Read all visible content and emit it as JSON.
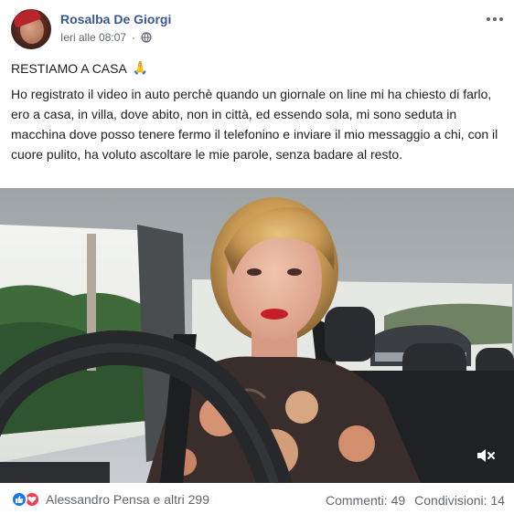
{
  "post": {
    "author": "Rosalba De Giorgi",
    "time": "Ieri alle 08:07",
    "privacy_icon": "globe-icon",
    "title": "RESTIAMO A CASA",
    "title_emoji": "🙏",
    "body": "Ho registrato il video in auto perchè quando un giornale on line mi ha chiesto di farlo, ero a casa, in villa, dove abito, non in città, ed essendo sola, mi sono seduta in macchina dove posso tenere fermo il telefonino e inviare il mio messaggio a chi, con il cuore pulito, ha voluto ascoltare le mie parole, senza badare al resto.",
    "more_icon": "more-options-icon"
  },
  "video": {
    "mute_icon": "speaker-muted-icon"
  },
  "footer": {
    "reactions_text": "Alessandro Pensa e altri 299",
    "comments": "Commenti: 49",
    "shares": "Condivisioni: 14"
  },
  "colors": {
    "link": "#385898",
    "secondary_text": "#616770",
    "like": "#1877f2",
    "love": "#f33e58"
  }
}
